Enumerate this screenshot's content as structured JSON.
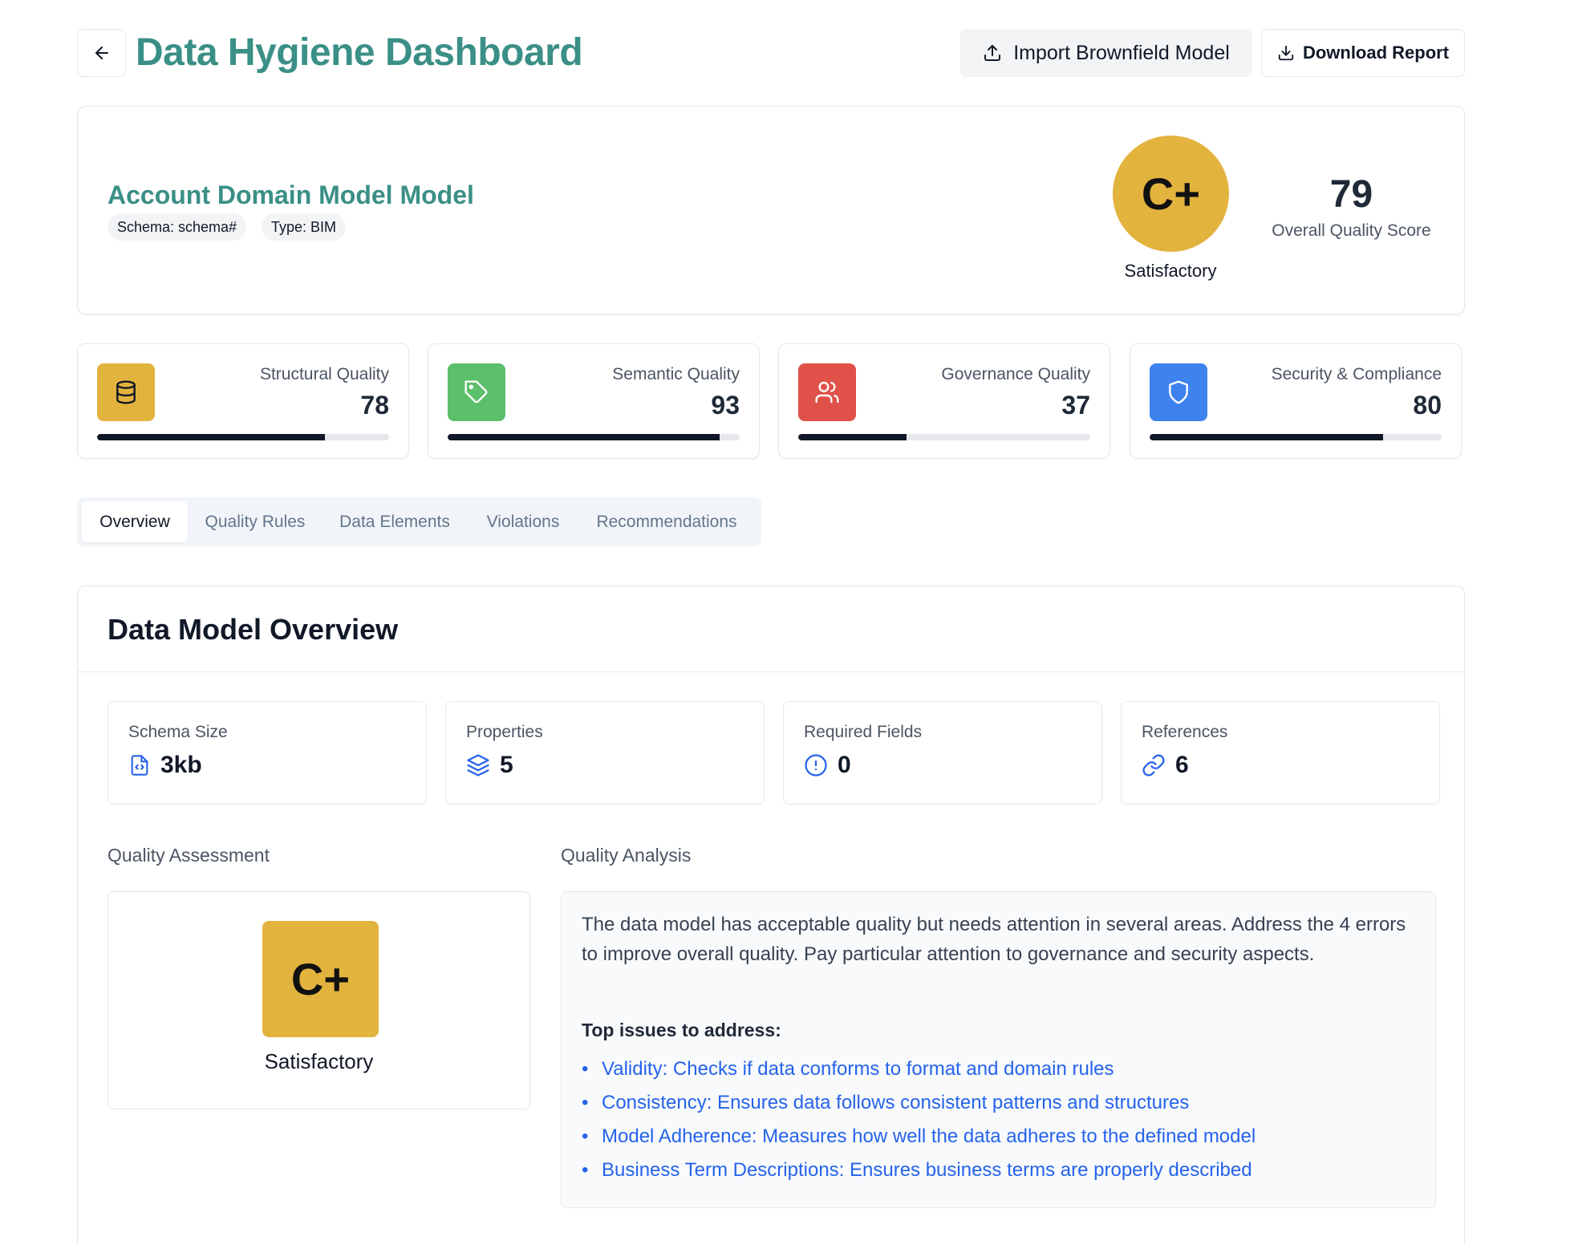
{
  "header": {
    "title": "Data Hygiene Dashboard",
    "import_label": "Import Brownfield Model",
    "download_label": "Download Report"
  },
  "model": {
    "name": "Account Domain Model Model",
    "schema_chip": "Schema: schema#",
    "type_chip": "Type: BIM",
    "grade": "C+",
    "grade_label": "Satisfactory",
    "overall_score": "79",
    "overall_label": "Overall Quality Score"
  },
  "metrics": [
    {
      "label": "Structural Quality",
      "value": "78",
      "progress": 0.78,
      "color": "#e2b33d",
      "icon": "database-icon"
    },
    {
      "label": "Semantic Quality",
      "value": "93",
      "progress": 0.93,
      "color": "#5cbf6a",
      "icon": "tag-icon"
    },
    {
      "label": "Governance Quality",
      "value": "37",
      "progress": 0.37,
      "color": "#e0514a",
      "icon": "users-icon"
    },
    {
      "label": "Security & Compliance",
      "value": "80",
      "progress": 0.8,
      "color": "#3d82ee",
      "icon": "shield-icon"
    }
  ],
  "tabs": [
    {
      "label": "Overview",
      "active": true
    },
    {
      "label": "Quality Rules"
    },
    {
      "label": "Data Elements"
    },
    {
      "label": "Violations"
    },
    {
      "label": "Recommendations"
    }
  ],
  "overview": {
    "title": "Data Model Overview",
    "stats": [
      {
        "label": "Schema Size",
        "value": "3kb",
        "icon": "file-code-icon"
      },
      {
        "label": "Properties",
        "value": "5",
        "icon": "layers-icon"
      },
      {
        "label": "Required Fields",
        "value": "0",
        "icon": "alert-circle-icon"
      },
      {
        "label": "References",
        "value": "6",
        "icon": "link-icon"
      }
    ],
    "assessment_label": "Quality Assessment",
    "assessment_grade": "C+",
    "assessment_text": "Satisfactory",
    "analysis_label": "Quality Analysis",
    "analysis_text": "The data model has acceptable quality but needs attention in several areas. Address the 4 errors to improve overall quality. Pay particular attention to governance and security aspects.",
    "issues_title": "Top issues to address:",
    "issues": [
      "Validity: Checks if data conforms to format and domain rules",
      "Consistency: Ensures data follows consistent patterns and structures",
      "Model Adherence: Measures how well the data adheres to the defined model",
      "Business Term Descriptions: Ensures business terms are properly described"
    ],
    "accent_color": "#3a8f86",
    "link_color": "#2563eb"
  }
}
